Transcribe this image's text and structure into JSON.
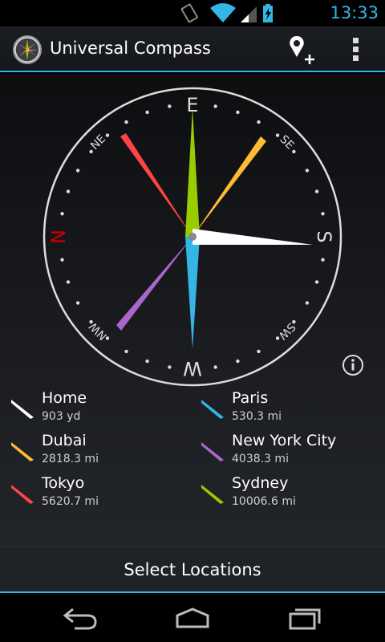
{
  "status": {
    "time": "13:33"
  },
  "app": {
    "title": "Universal Compass"
  },
  "colors": {
    "accent": "#33b5e5",
    "home": "#ffffff",
    "paris": "#33b5e5",
    "dubai": "#ffbb33",
    "nyc": "#aa66cc",
    "tokyo": "#ff4444",
    "sydney": "#99cc00",
    "north": "#cc0000"
  },
  "compass": {
    "labels": {
      "n": "N",
      "ne": "NE",
      "e": "E",
      "se": "SE",
      "s": "S",
      "sw": "SW",
      "w": "W",
      "nw": "NW"
    }
  },
  "locations": [
    {
      "name": "Home",
      "distance": "903 yd",
      "color": "#ffffff"
    },
    {
      "name": "Paris",
      "distance": "530.3 mi",
      "color": "#33b5e5"
    },
    {
      "name": "Dubai",
      "distance": "2818.3 mi",
      "color": "#ffbb33"
    },
    {
      "name": "New York City",
      "distance": "4038.3 mi",
      "color": "#aa66cc"
    },
    {
      "name": "Tokyo",
      "distance": "5620.7 mi",
      "color": "#ff4444"
    },
    {
      "name": "Sydney",
      "distance": "10006.6 mi",
      "color": "#99cc00"
    }
  ],
  "actions": {
    "select_locations": "Select Locations"
  },
  "icons": {
    "add_location": "add-location-icon",
    "overflow": "overflow-menu-icon",
    "info": "info-icon",
    "back": "back-icon",
    "home": "home-icon",
    "recents": "recent-apps-icon"
  }
}
